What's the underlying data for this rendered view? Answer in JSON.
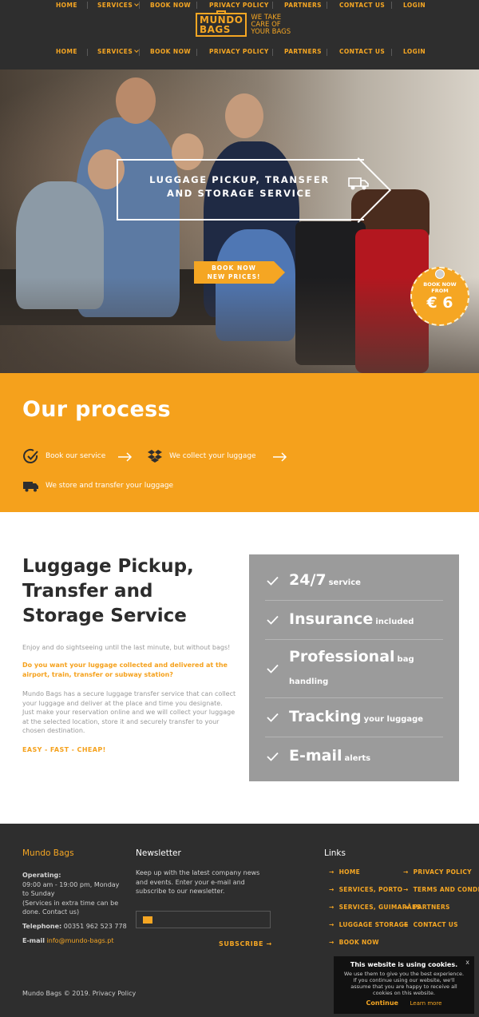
{
  "nav": {
    "home": "HOME",
    "services": "SERVICES",
    "book_now": "BOOK NOW",
    "privacy_policy": "PRIVACY POLICY",
    "partners": "PARTNERS",
    "contact_us": "CONTACT US",
    "login": "LOGIN"
  },
  "logo": {
    "word1": "MUNDO",
    "word2": "BAGS",
    "tagline_l1": "WE TAKE",
    "tagline_l2": "CARE OF",
    "tagline_l3": "YOUR BAGS"
  },
  "hero": {
    "title_l1": "LUGGAGE PICKUP, TRANSFER",
    "title_l2": "AND STORAGE SERVICE",
    "button_l1": "BOOK NOW",
    "button_l2": "NEW PRICES!",
    "badge_l1": "BOOK NOW",
    "badge_l2": "FROM",
    "badge_price": "€ 6"
  },
  "process": {
    "title": "Our process",
    "steps": [
      {
        "label": "Book our service",
        "icon": "check-circle-icon"
      },
      {
        "label": "We collect your luggage",
        "icon": "boxes-icon"
      },
      {
        "label": "We store and transfer your luggage",
        "icon": "truck-icon"
      }
    ]
  },
  "info": {
    "title": "Luggage Pickup, Transfer and Storage Service",
    "p1": "Enjoy and do sightseeing until the last minute, but without bags!",
    "question": "Do you want your luggage collected and delivered at the airport, train, transfer or subway station?",
    "p2": "Mundo Bags has a secure luggage transfer service that can collect your luggage and deliver at the place and time you designate. Just make your reservation online and we will collect your luggage at the selected location, store it and securely transfer to your chosen destination.",
    "easy": "EASY - FAST - CHEAP!"
  },
  "features": [
    {
      "big": "24/7",
      "small": "service"
    },
    {
      "big": "Insurance",
      "small": "included"
    },
    {
      "big": "Professional",
      "small": "bag",
      "small2": "handling"
    },
    {
      "big": "Tracking",
      "small": "your luggage"
    },
    {
      "big": "E-mail",
      "small": "alerts"
    }
  ],
  "footer": {
    "brand": "Mundo Bags",
    "operating_label": "Operating:",
    "operating_l1": "09:00 am - 19:00 pm, Monday",
    "operating_l2": "to Sunday",
    "operating_l3": "(Services in extra time can be",
    "operating_l4": "done. Contact us)",
    "telephone_label": "Telephone:",
    "telephone": "00351 962 523 778",
    "email_label": "E-mail",
    "email": "info@mundo-bags.pt",
    "newsletter_title": "Newsletter",
    "newsletter_l1": "Keep up with the latest company news",
    "newsletter_l2": "and events. Enter your e-mail and",
    "newsletter_l3": "subscribe to our newsletter.",
    "subscribe": "SUBSCRIBE",
    "links_title": "Links",
    "links_col1": [
      "HOME",
      "SERVICES, PORTO",
      "SERVICES, GUIMARÃES",
      "LUGGAGE STORAGE",
      "BOOK NOW"
    ],
    "links_col2": [
      "PRIVACY POLICY",
      "TERMS AND CONDITIONS",
      "PARTNERS",
      "CONTACT US"
    ],
    "copyright": "Mundo Bags © 2019. Privacy Policy"
  },
  "cookie": {
    "title": "This website is using cookies.",
    "body": "We use them to give you the best experience. If you continue using our website, we'll assume that you are happy to receive all cookies on this website.",
    "continue": "Continue",
    "learn_more": "Learn more",
    "close": "x"
  },
  "colors": {
    "accent": "#f5a623",
    "dark": "#2e2e2e",
    "process_bg": "#f5a11c",
    "features_bg": "#9b9b9b"
  }
}
